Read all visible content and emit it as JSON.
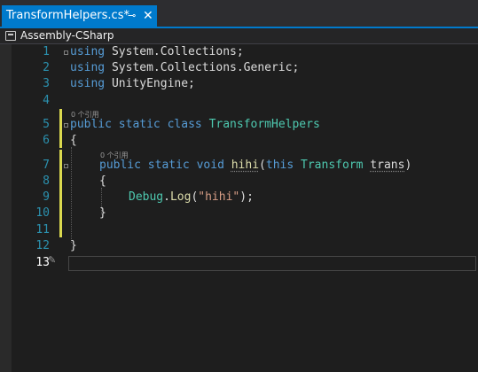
{
  "tab": {
    "title": "TransformHelpers.cs*",
    "pin_icon": "⊸",
    "close_icon": "✕"
  },
  "navbar": {
    "project": "Assembly-CSharp"
  },
  "editor": {
    "line_numbers": [
      "1",
      "2",
      "3",
      "4",
      "5",
      "6",
      "7",
      "8",
      "9",
      "10",
      "11",
      "12",
      "13"
    ],
    "codelens_class": "0 个引用",
    "codelens_method": "0 个引用",
    "code": {
      "l1_kw": "using",
      "l1_ns": "System.Collections;",
      "l2_kw": "using",
      "l2_ns": "System.Collections.Generic;",
      "l3_kw": "using",
      "l3_ns": "UnityEngine;",
      "l5_kw1": "public",
      "l5_kw2": "static",
      "l5_kw3": "class",
      "l5_name": "TransformHelpers",
      "l6_brace": "{",
      "l7_kw1": "public",
      "l7_kw2": "static",
      "l7_kw3": "void",
      "l7_method": "hihi",
      "l7_open": "(",
      "l7_kw4": "this",
      "l7_type": "Transform",
      "l7_param": "trans",
      "l7_close": ")",
      "l8_brace": "{",
      "l9_type": "Debug",
      "l9_dot": ".",
      "l9_method": "Log",
      "l9_open": "(",
      "l9_string": "\"hihi\"",
      "l9_close": ");",
      "l10_brace": "}",
      "l12_brace": "}"
    }
  }
}
